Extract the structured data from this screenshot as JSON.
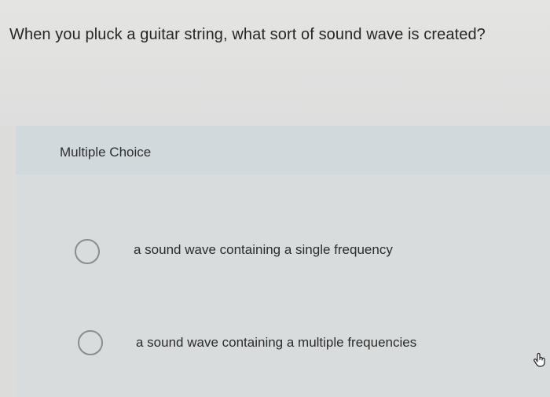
{
  "question": {
    "text": "When you pluck a guitar string, what sort of sound wave is created?"
  },
  "choices": {
    "header": "Multiple Choice",
    "options": [
      {
        "label": "a sound wave containing a single frequency",
        "selected": false
      },
      {
        "label": "a sound wave containing a multiple frequencies",
        "selected": false
      }
    ]
  },
  "icons": {
    "cursor": "hand-pointer-icon",
    "radio": "radio-circle-icon"
  }
}
